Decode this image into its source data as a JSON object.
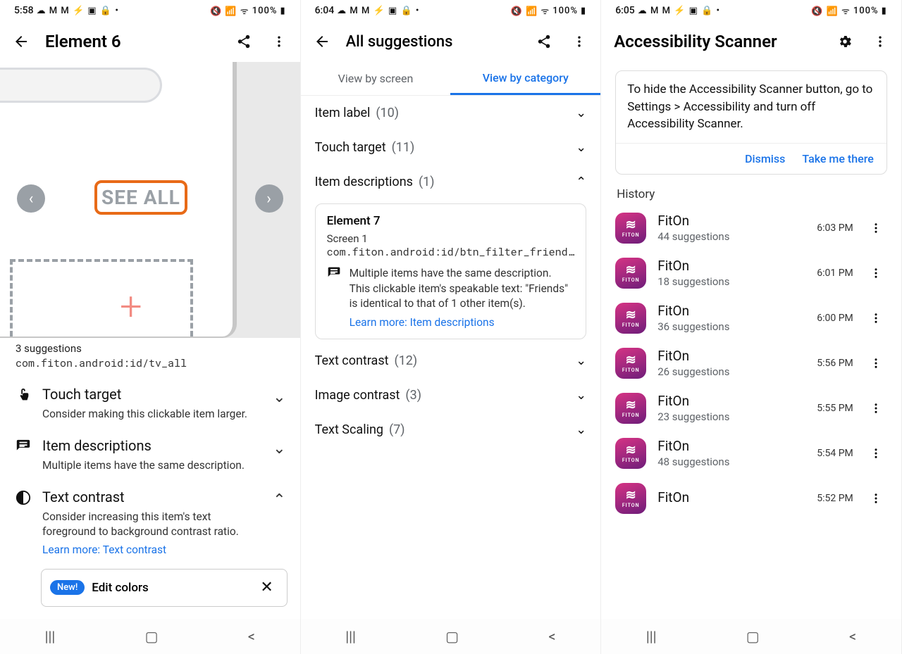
{
  "screen1": {
    "status": {
      "time": "5:58",
      "battery": "100%"
    },
    "title": "Element 6",
    "preview": {
      "highlight_text": "SEE ALL"
    },
    "suggestions_count": "3 suggestions",
    "resource_id": "com.fiton.android:id/tv_all",
    "items": [
      {
        "title": "Touch target",
        "desc": "Consider making this clickable item larger.",
        "expanded": false,
        "icon": "touch"
      },
      {
        "title": "Item descriptions",
        "desc": "Multiple items have the same description.",
        "expanded": false,
        "icon": "desc"
      },
      {
        "title": "Text contrast",
        "desc": "Consider increasing this item's text foreground to background contrast ratio.",
        "learn_more": "Learn more: Text contrast",
        "expanded": true,
        "icon": "contrast"
      }
    ],
    "pill": {
      "badge": "New!",
      "label": "Edit colors"
    }
  },
  "screen2": {
    "status": {
      "time": "6:04",
      "battery": "100%"
    },
    "title": "All suggestions",
    "tabs": {
      "left": "View by screen",
      "right": "View by category"
    },
    "categories": [
      {
        "label": "Item label",
        "count": "(10)",
        "expanded": false
      },
      {
        "label": "Touch target",
        "count": "(11)",
        "expanded": false
      },
      {
        "label": "Item descriptions",
        "count": "(1)",
        "expanded": true
      },
      {
        "label": "Text contrast",
        "count": "(12)",
        "expanded": false
      },
      {
        "label": "Image contrast",
        "count": "(3)",
        "expanded": false
      },
      {
        "label": "Text Scaling",
        "count": "(7)",
        "expanded": false
      }
    ],
    "card": {
      "heading": "Element 7",
      "screen": "Screen 1",
      "resource": "com.fiton.android:id/btn_filter_friend..",
      "line1": "Multiple items have the same description.",
      "line2": "This clickable item's speakable text: \"Friends\" is identical to that of 1 other item(s).",
      "learn_more": "Learn more: Item descriptions"
    }
  },
  "screen3": {
    "status": {
      "time": "6:05",
      "battery": "100%"
    },
    "title": "Accessibility Scanner",
    "info": "To hide the Accessibility Scanner button, go to Settings > Accessibility and turn off Accessibility Scanner.",
    "dismiss": "Dismiss",
    "take_me": "Take me there",
    "history_label": "History",
    "history": [
      {
        "name": "FitOn",
        "sub": "44 suggestions",
        "time": "6:03 PM"
      },
      {
        "name": "FitOn",
        "sub": "18 suggestions",
        "time": "6:01 PM"
      },
      {
        "name": "FitOn",
        "sub": "36 suggestions",
        "time": "6:00 PM"
      },
      {
        "name": "FitOn",
        "sub": "26 suggestions",
        "time": "5:56 PM"
      },
      {
        "name": "FitOn",
        "sub": "23 suggestions",
        "time": "5:55 PM"
      },
      {
        "name": "FitOn",
        "sub": "48 suggestions",
        "time": "5:54 PM"
      },
      {
        "name": "FitOn",
        "sub": "",
        "time": "5:52 PM"
      }
    ]
  }
}
